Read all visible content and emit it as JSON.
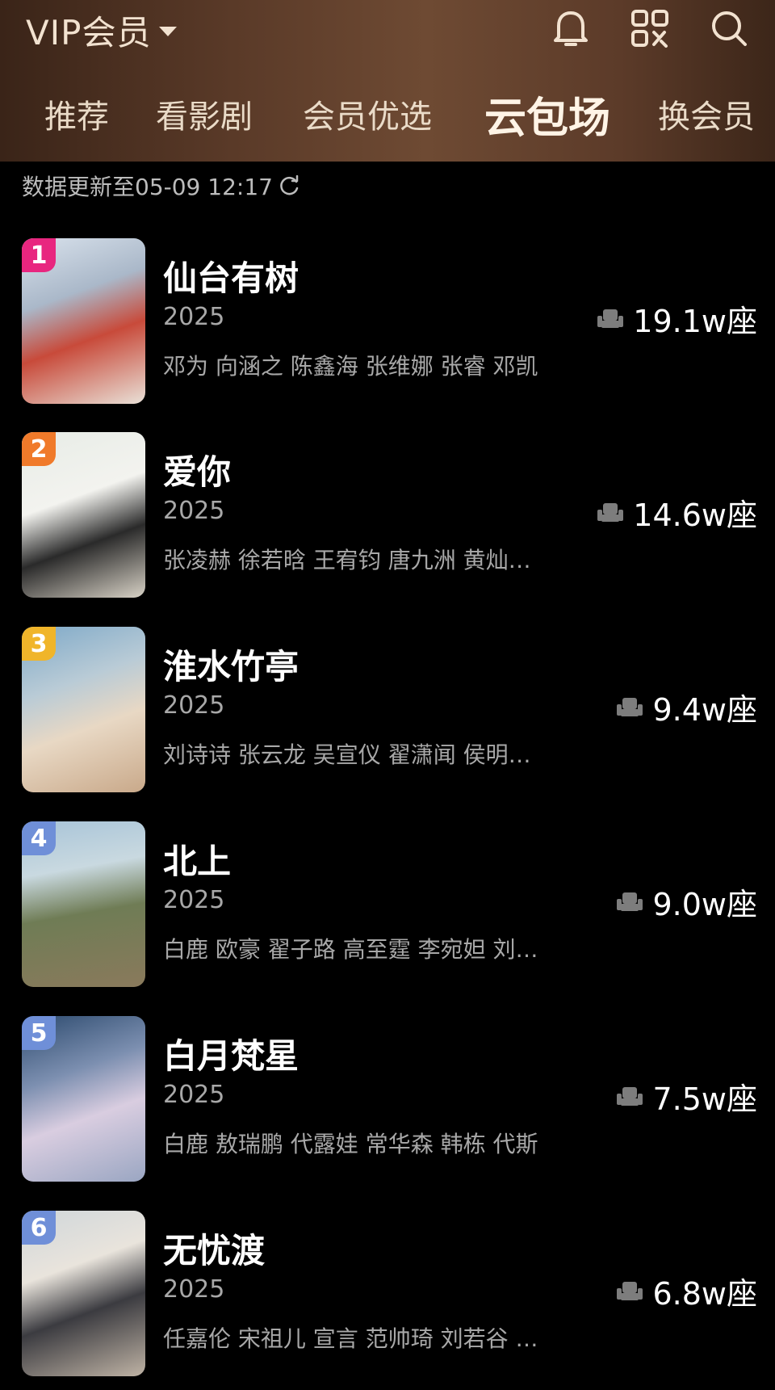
{
  "header": {
    "menu_label": "VIP会员",
    "icons": [
      "bell-icon",
      "scan-icon",
      "search-icon"
    ],
    "tabs": [
      {
        "label": "推荐",
        "active": false
      },
      {
        "label": "看影剧",
        "active": false
      },
      {
        "label": "会员优选",
        "active": false
      },
      {
        "label": "云包场",
        "active": true
      },
      {
        "label": "换会员",
        "active": false
      }
    ]
  },
  "update_text": "数据更新至05-09 12:17",
  "colors": {
    "rank_1": "#e8267f",
    "rank_2": "#f07a2a",
    "rank_3": "#f0b52a",
    "rank_other": "#6f8fd8"
  },
  "items": [
    {
      "rank": "1",
      "title": "仙台有树",
      "year": "2025",
      "cast": "邓为 向涵之 陈鑫海 张维娜 张睿 邓凯",
      "seats": "19.1w座"
    },
    {
      "rank": "2",
      "title": "爱你",
      "year": "2025",
      "cast": "张凌赫 徐若晗 王宥钧 唐九洲 黄灿…",
      "seats": "14.6w座"
    },
    {
      "rank": "3",
      "title": "淮水竹亭",
      "year": "2025",
      "cast": "刘诗诗 张云龙 吴宣仪 翟潇闻 侯明…",
      "seats": "9.4w座"
    },
    {
      "rank": "4",
      "title": "北上",
      "year": "2025",
      "cast": "白鹿 欧豪 翟子路 高至霆 李宛妲 刘…",
      "seats": "9.0w座"
    },
    {
      "rank": "5",
      "title": "白月梵星",
      "year": "2025",
      "cast": "白鹿 敖瑞鹏 代露娃 常华森 韩栋 代斯",
      "seats": "7.5w座"
    },
    {
      "rank": "6",
      "title": "无忧渡",
      "year": "2025",
      "cast": "任嘉伦 宋祖儿 宣言 范帅琦 刘若谷 …",
      "seats": "6.8w座"
    }
  ]
}
